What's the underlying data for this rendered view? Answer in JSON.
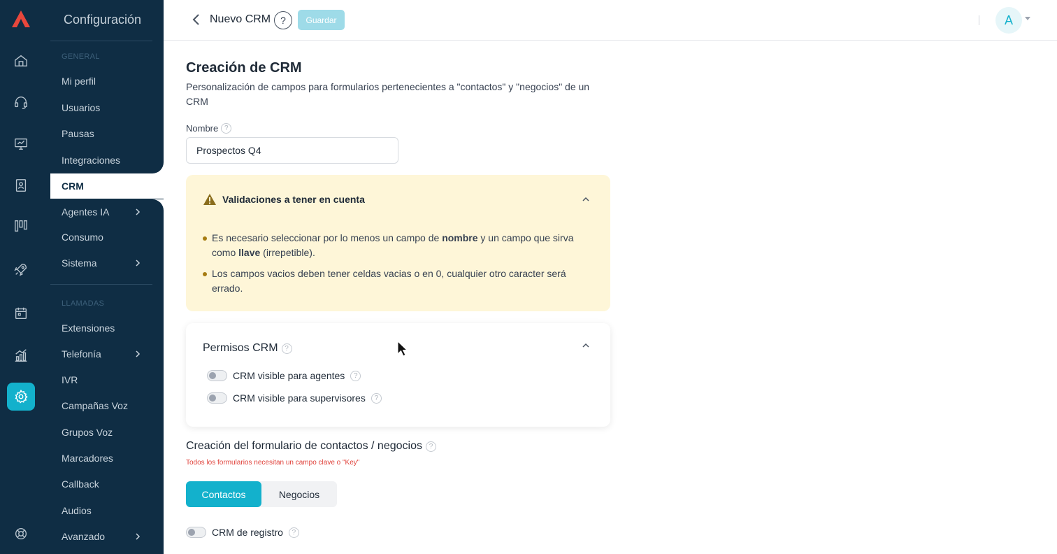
{
  "nav": {
    "title": "Configuración",
    "section_general": "GENERAL",
    "section_llamadas": "LLAMADAS",
    "items_general": [
      {
        "label": "Mi perfil"
      },
      {
        "label": "Usuarios"
      },
      {
        "label": "Pausas"
      },
      {
        "label": "Integraciones"
      },
      {
        "label": "CRM"
      },
      {
        "label": "Agentes IA"
      },
      {
        "label": "Consumo"
      },
      {
        "label": "Sistema"
      }
    ],
    "items_llamadas": [
      {
        "label": "Extensiones"
      },
      {
        "label": "Telefonía"
      },
      {
        "label": "IVR"
      },
      {
        "label": "Campañas Voz"
      },
      {
        "label": "Grupos Voz"
      },
      {
        "label": "Marcadores"
      },
      {
        "label": "Callback"
      },
      {
        "label": "Audios"
      },
      {
        "label": "Avanzado"
      }
    ]
  },
  "header": {
    "title": "Nuevo CRM",
    "help": "?",
    "save_label": "Guardar",
    "avatar_initial": "A"
  },
  "main": {
    "title": "Creación de CRM",
    "description": "Personalización de campos para formularios pertenecientes a \"contactos\" y \"negocios\" de un CRM",
    "name_label": "Nombre",
    "name_value": "Prospectos Q4",
    "validations": {
      "title": "Validaciones a tener en cuenta",
      "item1_a": "Es necesario seleccionar por lo menos un campo de ",
      "item1_b": "nombre",
      "item1_c": " y un campo que sirva como ",
      "item1_d": "llave",
      "item1_e": " (irrepetible).",
      "item2": "Los campos vacios deben tener celdas vacias o en 0, cualquier otro caracter será errado."
    },
    "permissions": {
      "title": "Permisos CRM",
      "toggle_agents": "CRM visible para agentes",
      "toggle_supervisors": "CRM visible para supervisores"
    },
    "form": {
      "title": "Creación del formulario de contactos / negocios",
      "warning": "Todos los formularios necesitan un campo clave o \"Key\"",
      "tab_contacts": "Contactos",
      "tab_business": "Negocios",
      "registry_toggle": "CRM de registro"
    }
  },
  "colors": {
    "sidebar": "#0f2d44",
    "accent": "#13b1cc",
    "warning_bg": "#fef6d8",
    "error_text": "#e0413a"
  }
}
